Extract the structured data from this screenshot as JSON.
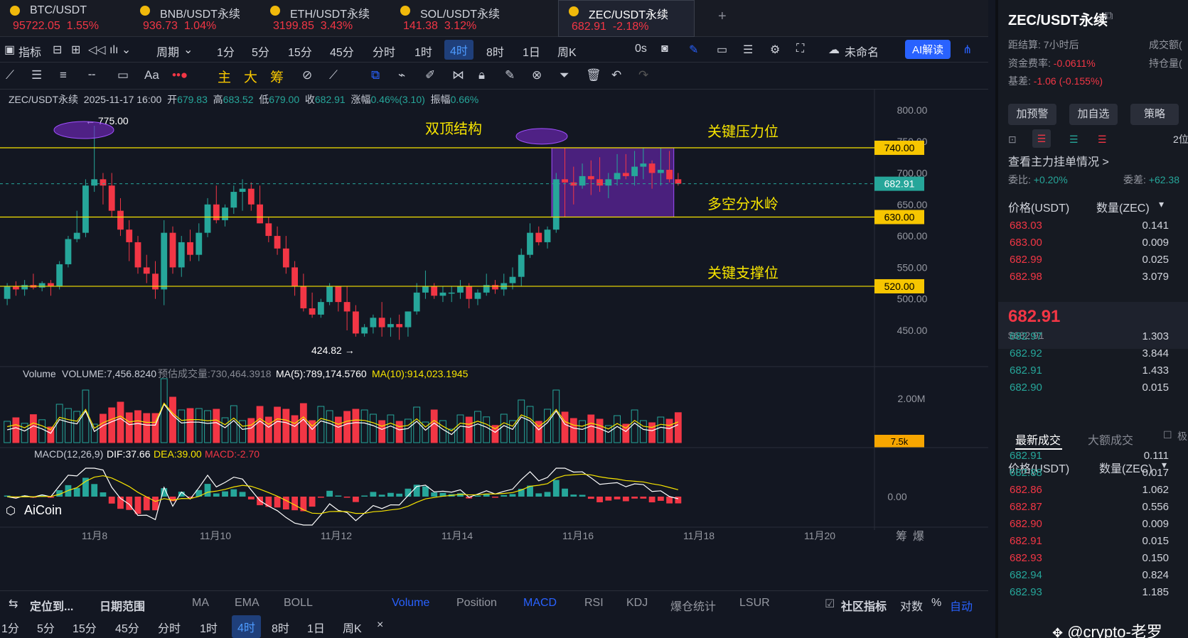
{
  "tabs": [
    {
      "symbol": "BTC/USDT",
      "price": "95722.05",
      "change": "1.55%"
    },
    {
      "symbol": "BNB/USDT永续",
      "price": "936.73",
      "change": "1.04%"
    },
    {
      "symbol": "ETH/USDT永续",
      "price": "3199.85",
      "change": "3.43%"
    },
    {
      "symbol": "SOL/USDT永续",
      "price": "141.38",
      "change": "3.12%"
    },
    {
      "symbol": "ZEC/USDT永续",
      "price": "682.91",
      "change": "-2.18%"
    }
  ],
  "toolbar": {
    "indicators": "指标",
    "period": "周期",
    "intervals": [
      "1分",
      "5分",
      "15分",
      "45分",
      "分时",
      "1时",
      "4时",
      "8时",
      "1日",
      "周K"
    ],
    "active_interval": "4时",
    "countdown": "0s",
    "unnamed": "未命名",
    "ai": "AI解读"
  },
  "drawtools": {
    "zhu": "主",
    "da": "大",
    "chou": "筹",
    "font": "Aa"
  },
  "info": {
    "symbol": "ZEC/USDT永续",
    "time": "2025-11-17 16:00",
    "open_label": "开",
    "open": "679.83",
    "high_label": "高",
    "high": "683.52",
    "low_label": "低",
    "low": "679.00",
    "close_label": "收",
    "close": "682.91",
    "change_label": "涨幅",
    "change": "0.46%(3.10)",
    "amp_label": "振幅",
    "amp": "0.66%"
  },
  "annotations": {
    "double_top": "双顶结构",
    "resistance": "关键压力位",
    "divide": "多空分水岭",
    "support": "关键支撑位",
    "high_mark": "← 775.00",
    "low_mark": "424.82 →"
  },
  "levels": {
    "resistance": "740.00",
    "current": "682.91",
    "divide": "630.00",
    "support": "520.00"
  },
  "yaxis": [
    "800.00",
    "750.00",
    "700.00",
    "650.00",
    "600.00",
    "550.00",
    "500.00",
    "450.00"
  ],
  "xaxis": [
    "11月8",
    "11月10",
    "11月12",
    "11月14",
    "11月16",
    "11月18",
    "11月20"
  ],
  "volume": {
    "label": "Volume",
    "value": "VOLUME:7,456.8240",
    "est": "预估成交量:730,464.3918",
    "ma5": "MA(5):789,174.5760",
    "ma10": "MA(10):914,023.1945",
    "axis": "2.00M",
    "current": "7.5k"
  },
  "macd": {
    "label": "MACD(12,26,9)",
    "dif": "DIF:37.66",
    "dea": "DEA:39.00",
    "macd": "MACD:-2.70",
    "axis": "0.00"
  },
  "logo": "AiCoin",
  "axis_corner": [
    "筹",
    "爆"
  ],
  "bottom1": {
    "locate": "定位到...",
    "range": "日期范围",
    "items": [
      "MA",
      "EMA",
      "BOLL",
      "Volume",
      "Position",
      "MACD",
      "RSI",
      "KDJ",
      "爆仓统计",
      "LSUR"
    ],
    "community": "社区指标",
    "log": "对数",
    "pct": "%",
    "auto": "自动"
  },
  "bottom2": {
    "intervals": [
      "1分",
      "5分",
      "15分",
      "45分",
      "分时",
      "1时",
      "4时",
      "8时",
      "1日",
      "周K"
    ],
    "close": "×"
  },
  "panel": {
    "title": "ZEC/USDT永续",
    "settle_label": "距结算:",
    "settle": "7小时后",
    "fund_label": "资金费率:",
    "fund": "-0.0611%",
    "basis_label": "基差:",
    "basis": "-1.06 (-0.155%)",
    "vol_label": "成交额(",
    "oi_label": "持仓量(",
    "btns": [
      "加预警",
      "加自选",
      "策略"
    ],
    "depth": "2位",
    "main_orders": "查看主力挂单情况 >",
    "ratio_label": "委比:",
    "ratio": "+0.20%",
    "diff_label": "委差:",
    "diff": "+62.38",
    "price_head": "价格(USDT)",
    "qty_head": "数量(ZEC)",
    "asks": [
      [
        "683.03",
        "0.141"
      ],
      [
        "683.00",
        "0.009"
      ],
      [
        "682.99",
        "0.025"
      ],
      [
        "682.98",
        "3.079"
      ]
    ],
    "last": "682.91",
    "last_usd": "$682.91",
    "bids": [
      [
        "682.97",
        "1.303"
      ],
      [
        "682.92",
        "3.844"
      ],
      [
        "682.91",
        "1.433"
      ],
      [
        "682.90",
        "0.015"
      ]
    ],
    "trade_tab1": "最新成交",
    "trade_tab2": "大额成交",
    "trade_tab3": "极",
    "trades": [
      [
        "682.91",
        "0.111",
        "g"
      ],
      [
        "682.88",
        "0.017",
        "g"
      ],
      [
        "682.86",
        "1.062",
        "r"
      ],
      [
        "682.87",
        "0.556",
        "r"
      ],
      [
        "682.90",
        "0.009",
        "r"
      ],
      [
        "682.91",
        "0.015",
        "r"
      ],
      [
        "682.93",
        "0.150",
        "r"
      ],
      [
        "682.94",
        "0.824",
        "g"
      ],
      [
        "682.93",
        "1.185",
        "g"
      ]
    ]
  },
  "watermark": "@crypto-老罗",
  "chart_data": {
    "type": "candlestick",
    "ylim": [
      415,
      810
    ],
    "note_candles": "approx 4h OHLC; index 0 ~ 2025-11-06 20:00",
    "ohlc": [
      [
        500,
        525,
        490,
        520
      ],
      [
        520,
        528,
        505,
        515
      ],
      [
        515,
        530,
        505,
        522
      ],
      [
        522,
        540,
        515,
        518
      ],
      [
        518,
        528,
        512,
        525
      ],
      [
        525,
        530,
        505,
        520
      ],
      [
        520,
        560,
        515,
        555
      ],
      [
        555,
        600,
        550,
        595
      ],
      [
        595,
        640,
        590,
        605
      ],
      [
        605,
        690,
        598,
        680
      ],
      [
        680,
        775,
        670,
        690
      ],
      [
        690,
        700,
        650,
        680
      ],
      [
        680,
        700,
        630,
        640
      ],
      [
        640,
        660,
        600,
        610
      ],
      [
        610,
        625,
        560,
        590
      ],
      [
        590,
        600,
        540,
        550
      ],
      [
        550,
        570,
        525,
        540
      ],
      [
        540,
        560,
        500,
        515
      ],
      [
        515,
        625,
        490,
        605
      ],
      [
        605,
        615,
        540,
        550
      ],
      [
        550,
        600,
        535,
        590
      ],
      [
        590,
        610,
        560,
        570
      ],
      [
        570,
        620,
        560,
        605
      ],
      [
        605,
        660,
        598,
        650
      ],
      [
        650,
        680,
        620,
        625
      ],
      [
        625,
        650,
        615,
        645
      ],
      [
        645,
        680,
        635,
        670
      ],
      [
        670,
        690,
        640,
        675
      ],
      [
        675,
        685,
        640,
        650
      ],
      [
        650,
        680,
        620,
        620
      ],
      [
        620,
        630,
        590,
        600
      ],
      [
        600,
        615,
        570,
        580
      ],
      [
        580,
        600,
        540,
        550
      ],
      [
        550,
        560,
        505,
        520
      ],
      [
        520,
        540,
        480,
        485
      ],
      [
        485,
        510,
        470,
        475
      ],
      [
        475,
        500,
        470,
        495
      ],
      [
        495,
        525,
        490,
        520
      ],
      [
        520,
        520,
        480,
        495
      ],
      [
        495,
        520,
        450,
        480
      ],
      [
        480,
        490,
        440,
        445
      ],
      [
        445,
        460,
        440,
        455
      ],
      [
        455,
        475,
        445,
        470
      ],
      [
        470,
        495,
        440,
        455
      ],
      [
        455,
        470,
        440,
        460
      ],
      [
        460,
        475,
        435,
        455
      ],
      [
        455,
        480,
        440,
        480
      ],
      [
        480,
        525,
        475,
        510
      ],
      [
        510,
        545,
        500,
        520
      ],
      [
        520,
        525,
        500,
        505
      ],
      [
        505,
        520,
        495,
        510
      ],
      [
        510,
        520,
        495,
        510
      ],
      [
        510,
        530,
        500,
        520
      ],
      [
        520,
        525,
        485,
        500
      ],
      [
        500,
        515,
        490,
        510
      ],
      [
        510,
        540,
        505,
        522
      ],
      [
        522,
        530,
        508,
        515
      ],
      [
        515,
        540,
        505,
        525
      ],
      [
        525,
        550,
        515,
        535
      ],
      [
        535,
        580,
        520,
        570
      ],
      [
        570,
        620,
        565,
        605
      ],
      [
        605,
        615,
        585,
        590
      ],
      [
        590,
        615,
        580,
        610
      ],
      [
        610,
        700,
        605,
        690
      ],
      [
        690,
        740,
        630,
        685
      ],
      [
        685,
        710,
        650,
        680
      ],
      [
        680,
        715,
        675,
        695
      ],
      [
        695,
        720,
        665,
        690
      ],
      [
        690,
        725,
        670,
        680
      ],
      [
        680,
        700,
        660,
        690
      ],
      [
        690,
        730,
        680,
        700
      ],
      [
        700,
        730,
        690,
        695
      ],
      [
        695,
        735,
        680,
        710
      ],
      [
        710,
        740,
        690,
        715
      ],
      [
        715,
        720,
        675,
        700
      ],
      [
        700,
        740,
        680,
        705
      ],
      [
        705,
        735,
        685,
        690
      ],
      [
        690,
        700,
        680,
        683
      ]
    ],
    "levels": [
      740,
      630,
      520
    ],
    "volume_series": "MA5 / MA10 overlays; axis 2.00M",
    "macd_series": {
      "dif": 37.66,
      "dea": 39.0,
      "macd": -2.7
    }
  }
}
